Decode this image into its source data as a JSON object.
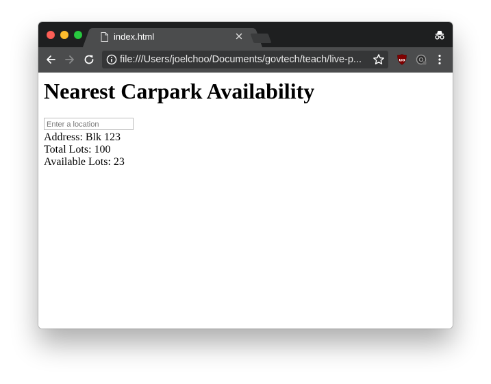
{
  "browser": {
    "tab_title": "index.html",
    "url": "file:///Users/joelchoo/Documents/govtech/teach/live-p..."
  },
  "page": {
    "title": "Nearest Carpark Availability",
    "location_input": {
      "placeholder": "Enter a location",
      "value": ""
    },
    "address_line": "Address: Blk 123",
    "total_lots_line": "Total Lots: 100",
    "available_lots_line": "Available Lots: 23"
  },
  "icons": {
    "window_controls": [
      "close-icon",
      "minimize-icon",
      "maximize-icon"
    ],
    "tab": [
      "document-icon",
      "close-tab-icon"
    ],
    "toolbar": [
      "back-arrow-icon",
      "forward-arrow-icon",
      "reload-icon",
      "info-icon",
      "star-icon",
      "ublock-origin-icon",
      "extension-icon",
      "menu-dots-icon"
    ],
    "titlebar": [
      "incognito-icon"
    ]
  },
  "colors": {
    "titlebar": "#1e1f20",
    "toolbar": "#4b4c4d",
    "omnibox": "#353637",
    "close": "#fc5f57",
    "minimize": "#fdbc2e",
    "maximize": "#28c840",
    "ublock": "#800000"
  }
}
